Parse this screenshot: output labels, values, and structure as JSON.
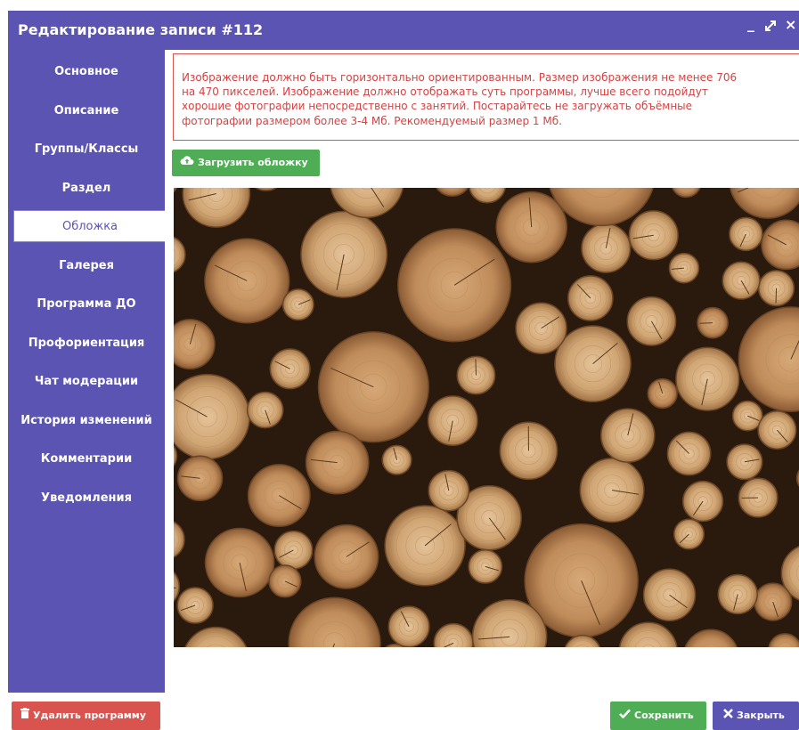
{
  "window": {
    "title": "Редактирование записи #112",
    "minimize_label": "_",
    "maximize_label": "⤢",
    "close_label": "×"
  },
  "sidebar": {
    "items": [
      {
        "label": "Основное",
        "active": false
      },
      {
        "label": "Описание",
        "active": false
      },
      {
        "label": "Группы/Классы",
        "active": false
      },
      {
        "label": "Раздел",
        "active": false
      },
      {
        "label": "Обложка",
        "active": true
      },
      {
        "label": "Галерея",
        "active": false
      },
      {
        "label": "Программа ДО",
        "active": false
      },
      {
        "label": "Профориентация",
        "active": false
      },
      {
        "label": "Чат модерации",
        "active": false
      },
      {
        "label": "История изменений",
        "active": false
      },
      {
        "label": "Комментарии",
        "active": false
      },
      {
        "label": "Уведомления",
        "active": false
      }
    ]
  },
  "content": {
    "warning_lines": [
      "Изображение должно быть горизонтально ориентированным. Размер изображения не менее 706",
      "на 470 пикселей. Изображение должно отображать суть программы, лучше всего подойдут",
      "хорошие фотографии непосредственно с занятий. Постарайтесь не загружать объёмные",
      "фотографии размером более 3-4 Мб. Рекомендуемый размер 1 Мб."
    ],
    "upload_label": "Загрузить обложку",
    "upload_icon": "cloud-upload-icon"
  },
  "footer": {
    "delete_label": "Удалить программу",
    "delete_icon": "trash-icon",
    "save_label": "Сохранить",
    "save_icon": "check-icon",
    "close_label": "Закрыть",
    "close_icon": "close-icon"
  },
  "colors": {
    "accent": "#5c54b2",
    "success": "#4fae55",
    "danger": "#d9534f"
  }
}
